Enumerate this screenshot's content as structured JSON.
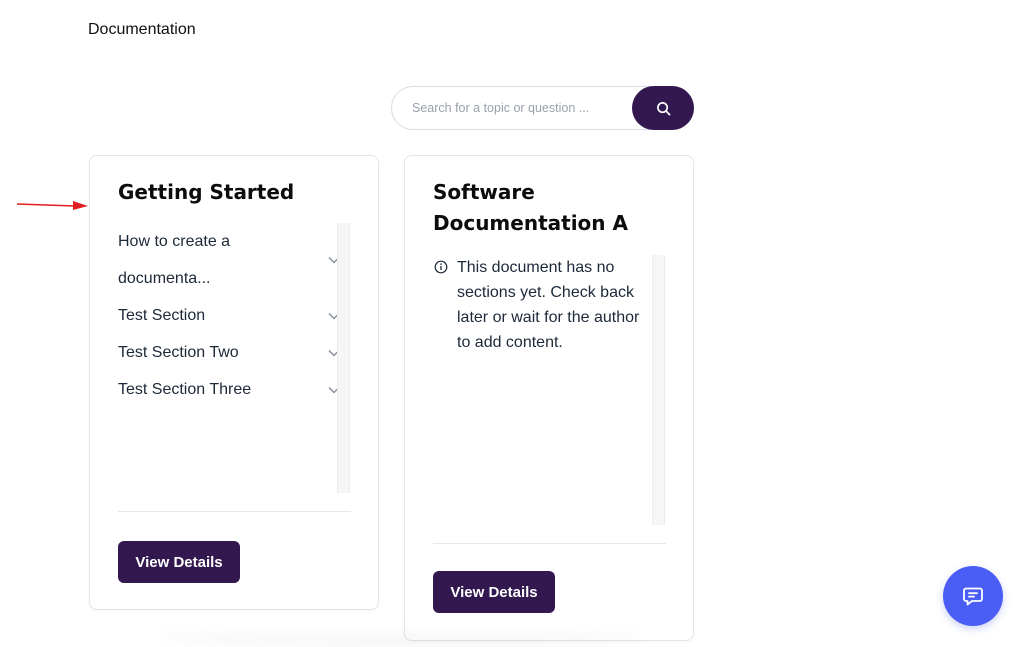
{
  "header": {
    "title": "Documentation"
  },
  "search": {
    "placeholder": "Search for a topic or question ...",
    "value": ""
  },
  "cards": [
    {
      "title": "Getting Started",
      "sections": [
        {
          "label_line1": "How to create a",
          "label_line2": "documenta..."
        },
        {
          "label": "Test Section"
        },
        {
          "label": "Test Section Two"
        },
        {
          "label": "Test Section Three"
        }
      ],
      "button_label": "View Details"
    },
    {
      "title": "Software Documentation A",
      "empty_message": "This document has no sections yet. Check back later or wait for the author to add content.",
      "button_label": "View Details"
    }
  ],
  "colors": {
    "primary": "#33184f",
    "chat_fab": "#4a5ef5",
    "annotation_arrow": "#e02020"
  },
  "icons": {
    "search": "search-icon",
    "chevron": "chevron-down-icon",
    "info": "info-icon",
    "chat": "chat-icon"
  }
}
